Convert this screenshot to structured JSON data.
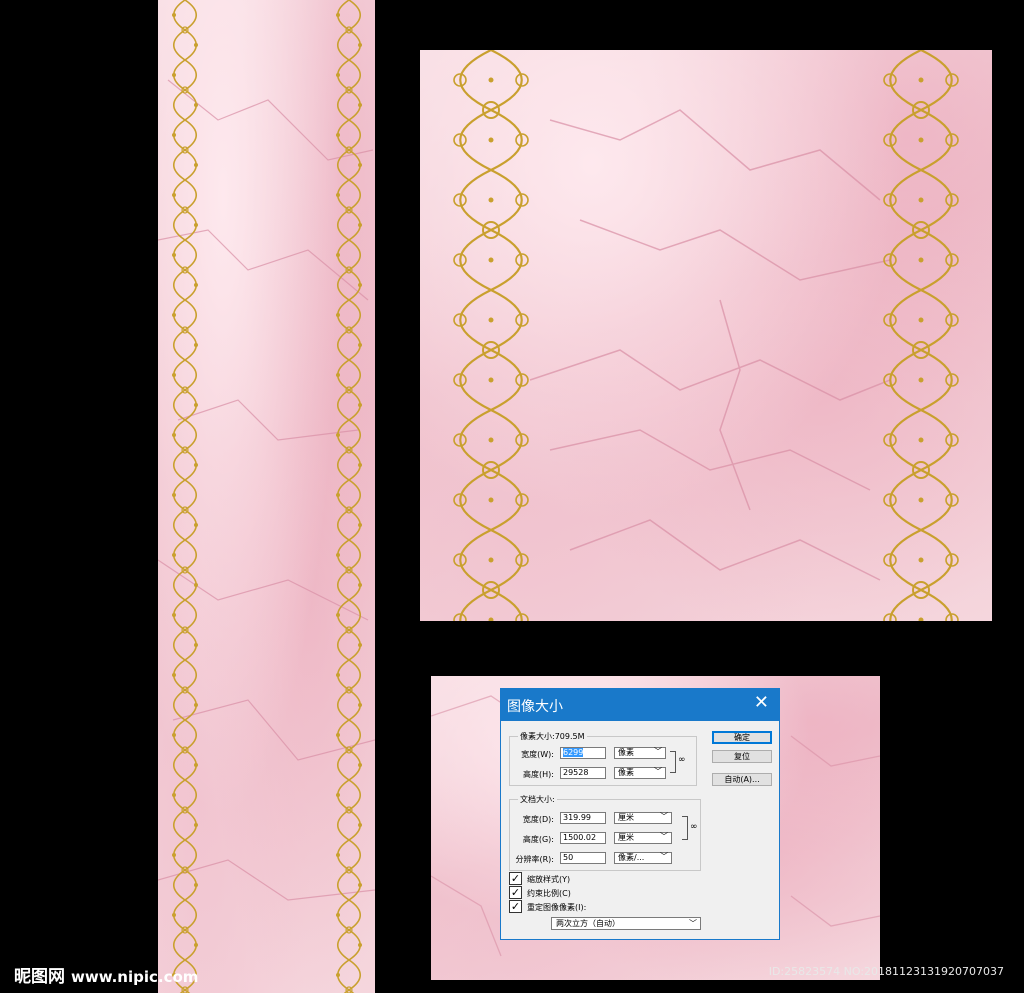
{
  "dialog": {
    "title": "图像大小",
    "pixel_size_label": "像素大小:709.5M",
    "pixel_width_label": "宽度(W):",
    "pixel_width_value": "6299",
    "pixel_width_unit": "像素",
    "pixel_height_label": "高度(H):",
    "pixel_height_value": "29528",
    "pixel_height_unit": "像素",
    "doc_size_label": "文档大小:",
    "doc_width_label": "宽度(D):",
    "doc_width_value": "319.99",
    "doc_width_unit": "厘米",
    "doc_height_label": "高度(G):",
    "doc_height_value": "1500.02",
    "doc_height_unit": "厘米",
    "resolution_label": "分辨率(R):",
    "resolution_value": "50",
    "resolution_unit": "像素/...",
    "ok_label": "确定",
    "reset_label": "复位",
    "auto_label": "自动(A)...",
    "scale_styles_label": "缩放样式(Y)",
    "constrain_label": "约束比例(C)",
    "resample_label": "重定图像像素(I):",
    "resample_method": "两次立方（自动）"
  },
  "watermark": {
    "brand": "昵图网",
    "url": "www.nipic.com",
    "id_text": "ID:25823574 NO:20181123131920707037"
  },
  "colors": {
    "marble_base": "#f2cfd6",
    "vein": "#d98fa5",
    "gold": "#c9a02e",
    "dialog_title_bg": "#1979ca"
  }
}
